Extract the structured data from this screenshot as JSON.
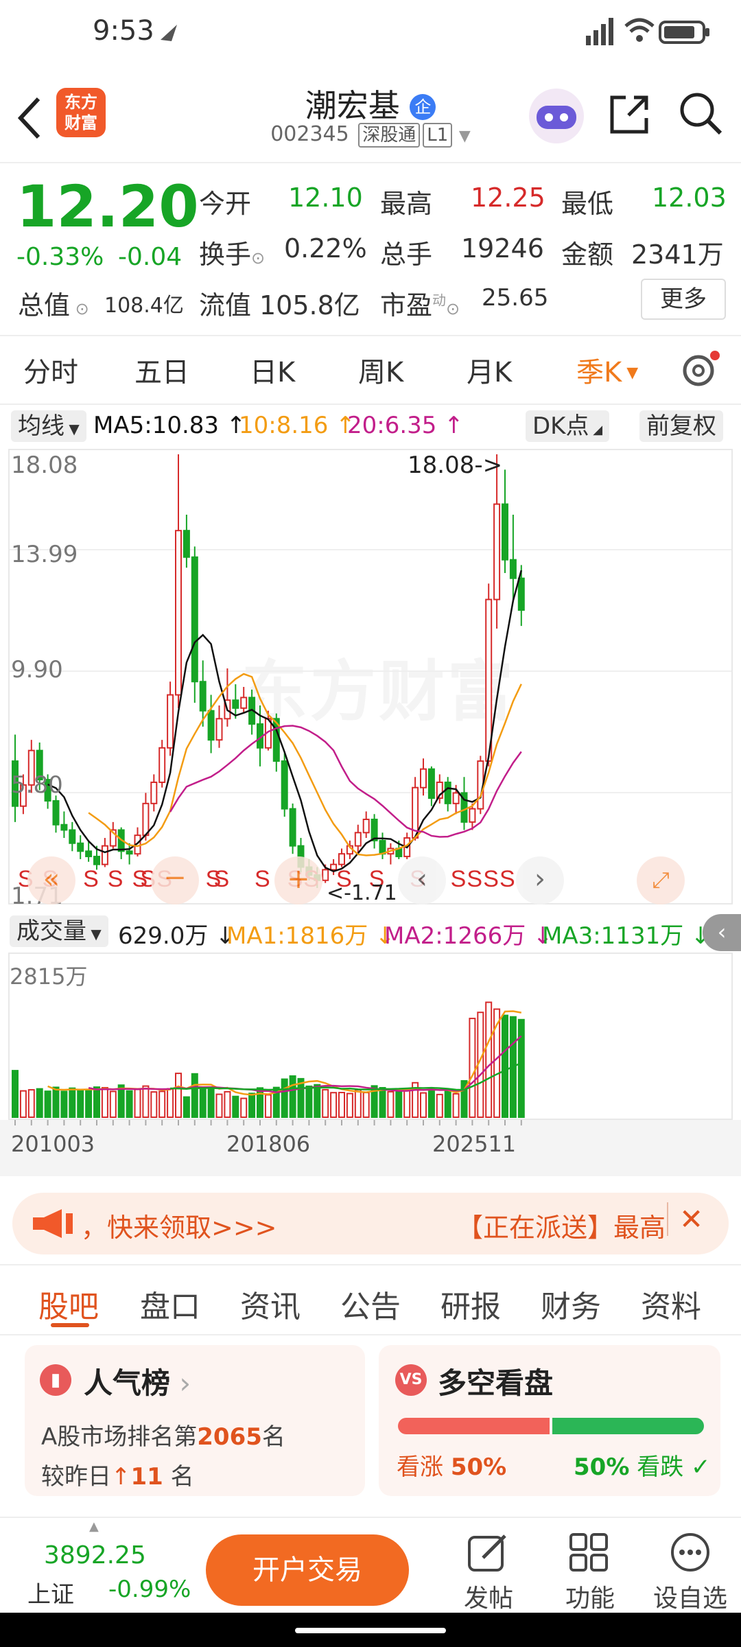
{
  "status": {
    "time": "9:53"
  },
  "header": {
    "title": "潮宏基",
    "code": "002345",
    "market": "深股通",
    "level": "L1",
    "logo_text": [
      "东方",
      "财富"
    ]
  },
  "quote": {
    "price": "12.20",
    "change_pct": "-0.33%",
    "change": "-0.04",
    "open_label": "今开",
    "open": "12.10",
    "high_label": "最高",
    "high": "12.25",
    "low_label": "最低",
    "low": "12.03",
    "turnover_label": "换手",
    "turnover": "0.22%",
    "volume_label": "总手",
    "volume": "19246",
    "amount_label": "金额",
    "amount": "2341万",
    "mktcap_label": "总值",
    "mktcap": "108.4亿",
    "float_label": "流值",
    "float": "105.8亿",
    "pe_label": "市盈",
    "pe_sup": "动",
    "pe": "25.65",
    "more": "更多"
  },
  "tabs": [
    "分时",
    "五日",
    "日K",
    "周K",
    "月K",
    "季K"
  ],
  "active_tab": "季K",
  "chart": {
    "ma_label": "均线",
    "ma5": "MA5:10.83",
    "ma10": "10:8.16",
    "ma20": "20:6.35",
    "dk": "DK点",
    "adjust": "前复权",
    "y_labels": [
      "18.08",
      "13.99",
      "9.90",
      "5.80",
      "1.71"
    ],
    "max_annot": "18.08->",
    "min_annot": "<-1.71",
    "vol_label": "成交量",
    "vol_value": "629.0万",
    "vol_ma1": "MA1:1816万",
    "vol_ma2": "MA2:1266万",
    "vol_ma3": "MA3:1131万",
    "vol_max": "2815万",
    "x_labels": [
      "201003",
      "201806",
      "202511"
    ],
    "watermark": "东方财富",
    "colors": {
      "up": "#d62a2a",
      "down": "#17a526",
      "ma5": "#111111",
      "ma10": "#f39c12",
      "ma20": "#c21e8a"
    }
  },
  "chart_data": {
    "type": "candlestick",
    "period": "quarterly",
    "ylim": [
      1.71,
      18.08
    ],
    "x_ticks": [
      "201003",
      "201806",
      "202511"
    ],
    "ohlc": [
      [
        6.5,
        7.5,
        4.2,
        4.8
      ],
      [
        4.8,
        6.0,
        4.5,
        5.6
      ],
      [
        5.6,
        7.3,
        5.3,
        6.9
      ],
      [
        6.9,
        7.2,
        5.4,
        5.8
      ],
      [
        5.8,
        6.0,
        4.7,
        5.0
      ],
      [
        5.0,
        5.2,
        3.8,
        4.1
      ],
      [
        4.1,
        4.6,
        3.6,
        3.9
      ],
      [
        3.9,
        4.2,
        3.1,
        3.4
      ],
      [
        3.4,
        3.7,
        2.8,
        3.1
      ],
      [
        3.1,
        3.5,
        2.7,
        2.9
      ],
      [
        2.9,
        3.3,
        2.4,
        2.6
      ],
      [
        2.6,
        3.6,
        2.5,
        3.3
      ],
      [
        3.3,
        4.2,
        3.2,
        3.9
      ],
      [
        3.9,
        4.0,
        2.8,
        3.1
      ],
      [
        3.1,
        3.4,
        2.6,
        3.0
      ],
      [
        3.0,
        4.0,
        2.9,
        3.7
      ],
      [
        3.7,
        5.3,
        3.5,
        4.9
      ],
      [
        4.9,
        6.0,
        4.6,
        5.7
      ],
      [
        5.7,
        7.3,
        5.5,
        7.0
      ],
      [
        7.0,
        9.5,
        6.7,
        9.0
      ],
      [
        9.0,
        18.08,
        8.5,
        15.2
      ],
      [
        15.2,
        15.8,
        13.8,
        14.2
      ],
      [
        14.2,
        14.6,
        8.7,
        9.5
      ],
      [
        9.5,
        10.3,
        7.8,
        8.4
      ],
      [
        8.4,
        9.0,
        6.8,
        7.3
      ],
      [
        7.3,
        8.6,
        7.0,
        8.1
      ],
      [
        8.1,
        10.0,
        7.8,
        8.8
      ],
      [
        8.8,
        9.4,
        8.1,
        8.5
      ],
      [
        8.5,
        9.3,
        8.3,
        8.9
      ],
      [
        8.9,
        9.2,
        7.5,
        7.9
      ],
      [
        7.9,
        8.6,
        6.3,
        7.0
      ],
      [
        7.0,
        8.4,
        6.9,
        8.1
      ],
      [
        8.1,
        8.3,
        6.1,
        6.5
      ],
      [
        6.5,
        6.8,
        4.4,
        4.7
      ],
      [
        4.7,
        4.9,
        3.0,
        3.3
      ],
      [
        3.3,
        3.6,
        2.3,
        2.5
      ],
      [
        2.5,
        2.8,
        2.0,
        2.2
      ],
      [
        2.2,
        2.5,
        1.71,
        2.0
      ],
      [
        2.0,
        2.6,
        1.9,
        2.4
      ],
      [
        2.4,
        2.8,
        2.2,
        2.6
      ],
      [
        2.6,
        3.2,
        2.5,
        3.0
      ],
      [
        3.0,
        3.5,
        2.8,
        3.3
      ],
      [
        3.3,
        4.1,
        3.0,
        3.8
      ],
      [
        3.8,
        4.6,
        3.6,
        4.3
      ],
      [
        4.3,
        4.5,
        3.2,
        3.5
      ],
      [
        3.5,
        3.8,
        2.8,
        3.0
      ],
      [
        3.0,
        3.4,
        2.6,
        3.2
      ],
      [
        3.2,
        3.5,
        2.8,
        2.9
      ],
      [
        2.9,
        3.8,
        2.8,
        3.6
      ],
      [
        3.6,
        5.9,
        3.5,
        5.5
      ],
      [
        5.5,
        6.6,
        5.2,
        6.2
      ],
      [
        6.2,
        6.3,
        4.8,
        5.1
      ],
      [
        5.1,
        6.0,
        4.9,
        5.7
      ],
      [
        5.7,
        5.9,
        4.6,
        4.9
      ],
      [
        4.9,
        5.6,
        4.5,
        5.3
      ],
      [
        5.3,
        5.9,
        3.9,
        4.2
      ],
      [
        4.2,
        4.9,
        3.9,
        4.7
      ],
      [
        4.7,
        6.7,
        4.5,
        6.5
      ],
      [
        6.5,
        13.2,
        6.3,
        12.6
      ],
      [
        12.6,
        18.08,
        11.5,
        16.2
      ],
      [
        16.2,
        17.5,
        13.6,
        14.1
      ],
      [
        14.1,
        15.8,
        12.5,
        13.4
      ],
      [
        13.4,
        13.9,
        11.6,
        12.2
      ]
    ],
    "volume_max": 2815
  },
  "banner": {
    "left_text": "，快来领取>>>",
    "right_text": "【正在派送】最高",
    "close": "✕"
  },
  "news_tabs": [
    "股吧",
    "盘口",
    "资讯",
    "公告",
    "研报",
    "财务",
    "资料"
  ],
  "active_news_tab": "股吧",
  "popularity": {
    "title": "人气榜",
    "line1_prefix": "A股市场排名第",
    "rank": "2065",
    "line1_suffix": "名",
    "line2_prefix": "较昨日",
    "delta": "11",
    "line2_suffix": "名"
  },
  "vs": {
    "title": "多空看盘",
    "bull_label": "看涨",
    "bull_pct": "50%",
    "bear_pct": "50%",
    "bear_label": "看跌",
    "bull": 0.5
  },
  "bottom": {
    "index_value": "3892.25",
    "index_name": "上证",
    "index_change": "-0.99%",
    "trade_btn": "开户交易",
    "post": "发帖",
    "func": "功能",
    "watch": "设自选"
  }
}
